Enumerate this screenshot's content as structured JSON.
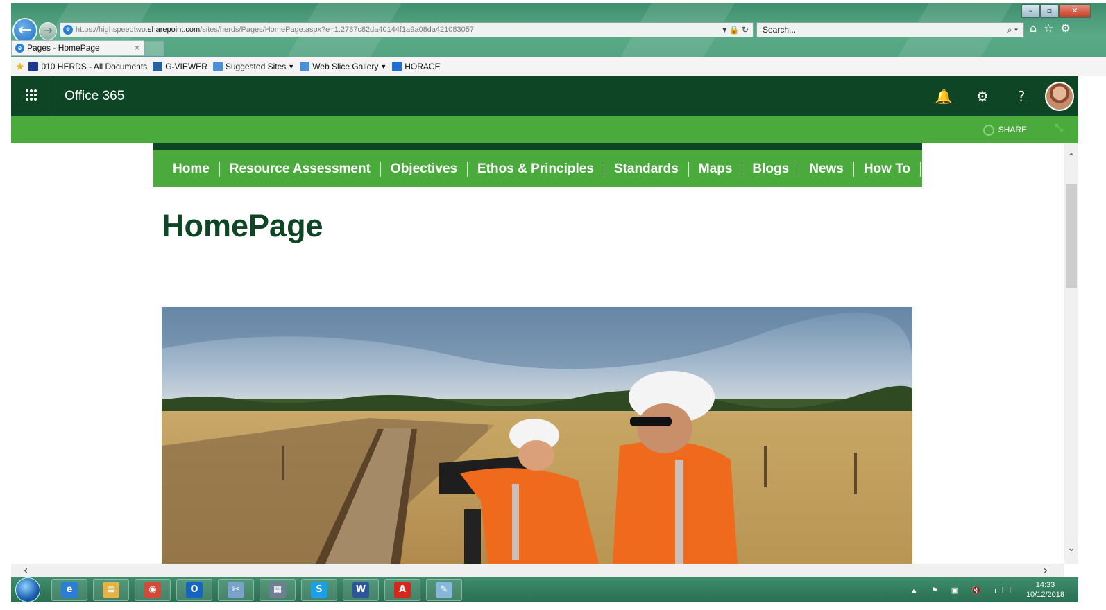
{
  "browser": {
    "url_prefix": "https://highspeedtwo.",
    "url_domain": "sharepoint.com",
    "url_path": "/sites/herds/Pages/HomePage.aspx?e=1:2787c82da40144f1a9a08da421083057",
    "url_tools": "▾ 🔒 ↻",
    "search_placeholder": "Search...",
    "tab_title": "Pages - HomePage",
    "tab_close": "×"
  },
  "favorites": [
    {
      "label": "010 HERDS - All Documents",
      "icon": "hs2-icon",
      "color": "#1b3a8f",
      "dropdown": false
    },
    {
      "label": "G-VIEWER",
      "icon": "gviewer-icon",
      "color": "#2a5f9e",
      "dropdown": false
    },
    {
      "label": "Suggested Sites",
      "icon": "ie-page-icon",
      "color": "#4a90d9",
      "dropdown": true
    },
    {
      "label": "Web Slice Gallery",
      "icon": "ie-page-icon",
      "color": "#4a90d9",
      "dropdown": true
    },
    {
      "label": "HORACE",
      "icon": "horace-icon",
      "color": "#1c6fd1",
      "dropdown": false
    }
  ],
  "suite": {
    "brand": "Office 365",
    "bell": "🔔",
    "gear": "⚙",
    "help": "?"
  },
  "site": {
    "share_label": "SHARE"
  },
  "nav": [
    "Home",
    "Resource Assessment",
    "Objectives",
    "Ethos & Principles",
    "Standards",
    "Maps",
    "Blogs",
    "News",
    "How To"
  ],
  "page": {
    "title": "HomePage"
  },
  "taskbar": {
    "apps": [
      {
        "name": "ie",
        "glyph": "e",
        "color": "#2a7fd4"
      },
      {
        "name": "explorer",
        "glyph": "▤",
        "color": "#e3b445"
      },
      {
        "name": "chrome",
        "glyph": "◉",
        "color": "#d44a3a"
      },
      {
        "name": "outlook",
        "glyph": "O",
        "color": "#1565c0"
      },
      {
        "name": "snipping",
        "glyph": "✂",
        "color": "#7aa2c8"
      },
      {
        "name": "calculator",
        "glyph": "▦",
        "color": "#6d7f90"
      },
      {
        "name": "skype",
        "glyph": "S",
        "color": "#1aa0e6"
      },
      {
        "name": "word",
        "glyph": "W",
        "color": "#2b579a"
      },
      {
        "name": "acrobat",
        "glyph": "A",
        "color": "#d8261c"
      },
      {
        "name": "notes",
        "glyph": "✎",
        "color": "#88b8d8"
      }
    ],
    "time": "14:33",
    "date": "10/12/2018"
  },
  "colors": {
    "suite_bar": "#0d4525",
    "site_green": "#4aab3c",
    "title_green": "#0d4525"
  }
}
